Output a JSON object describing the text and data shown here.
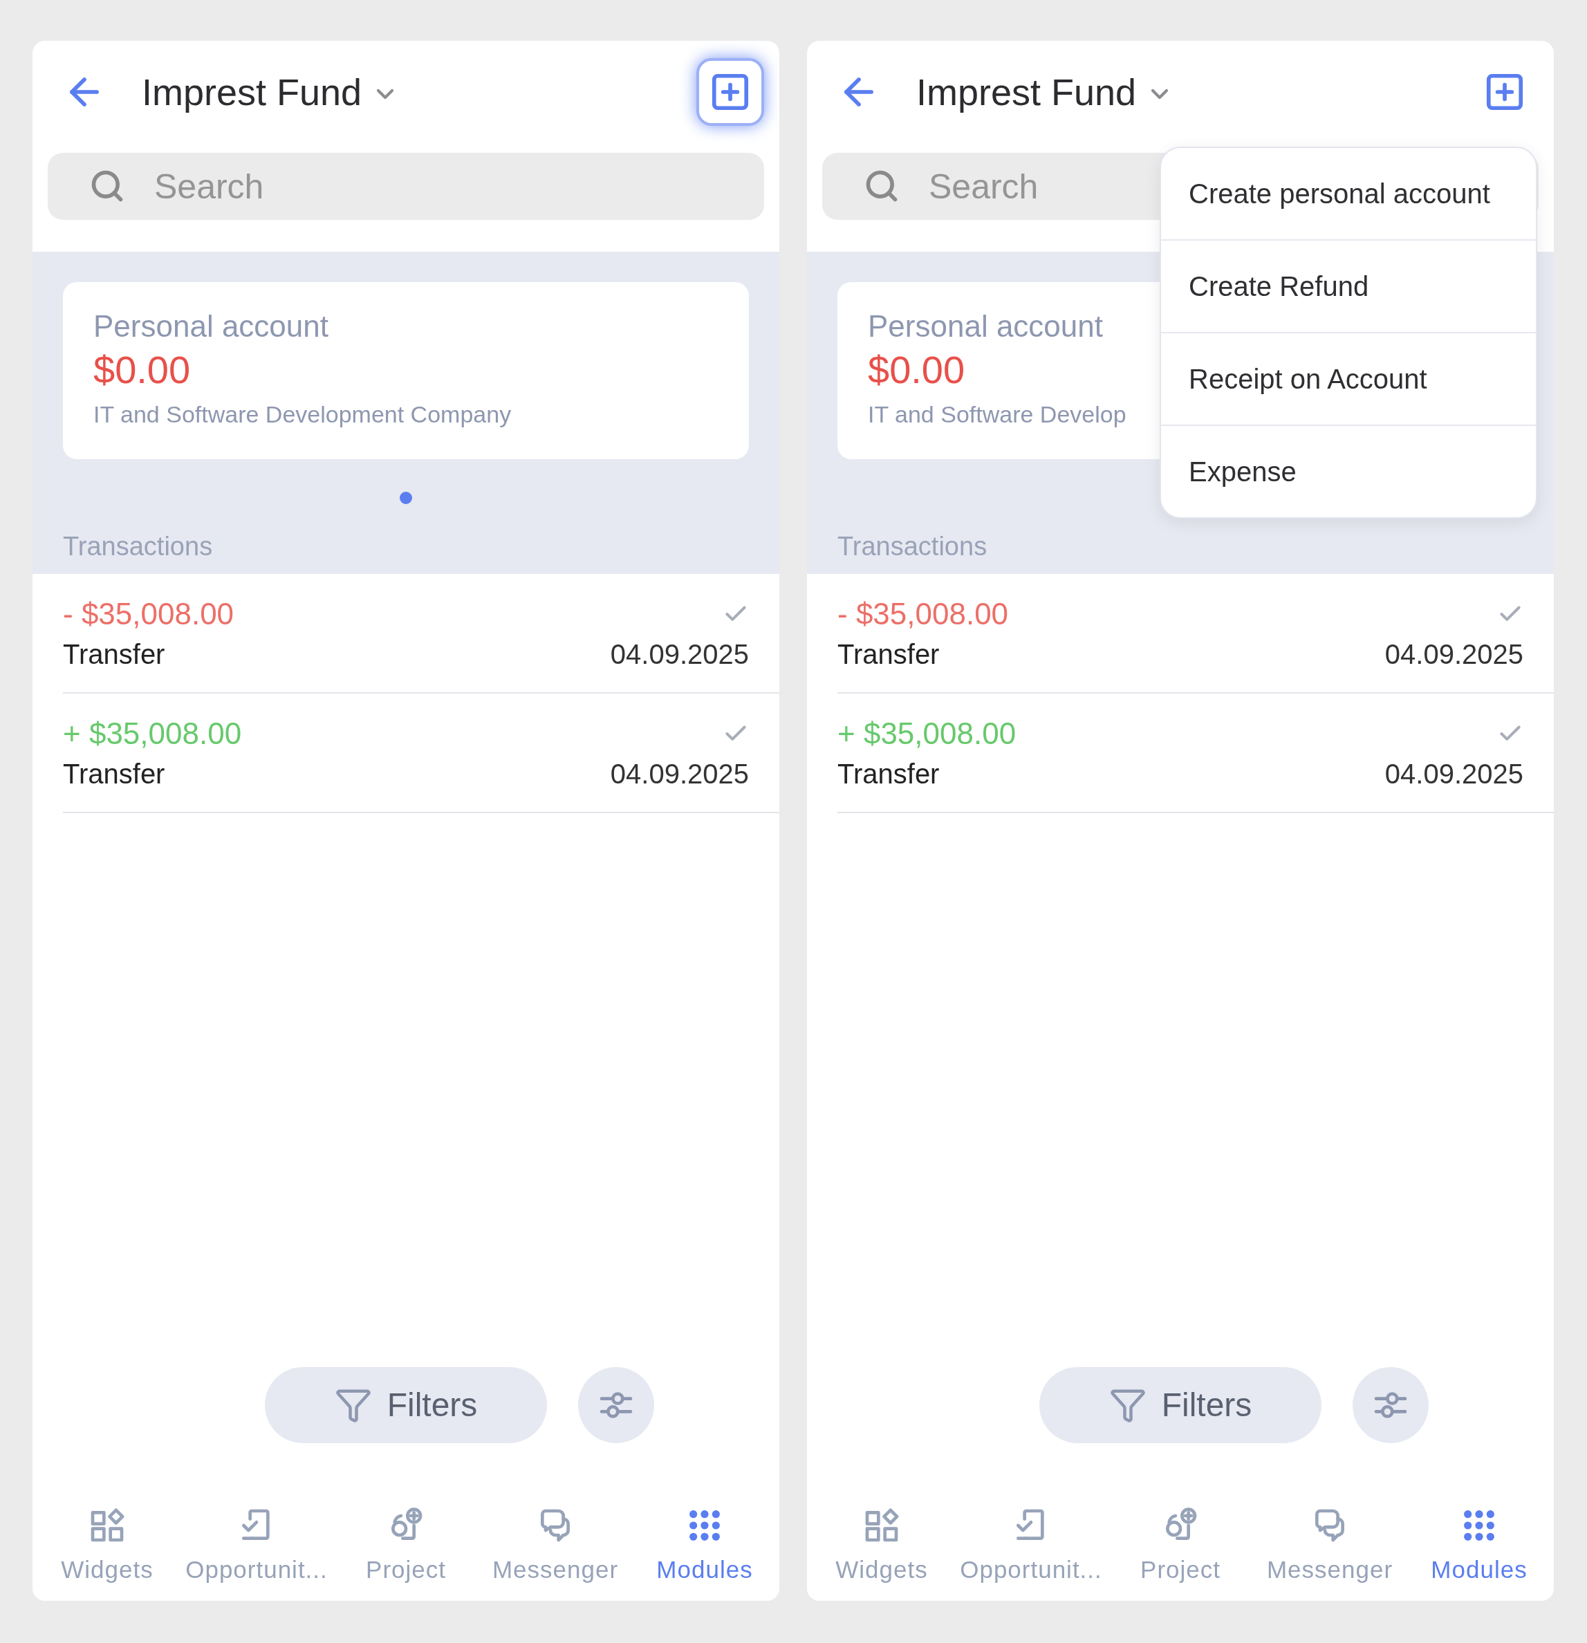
{
  "screens": [
    {
      "title": "Imprest Fund",
      "add_button_focused": true,
      "search": {
        "placeholder": "Search"
      },
      "account_card": {
        "label": "Personal account",
        "balance": "$0.00",
        "company": "IT and Software Development Company"
      },
      "page_dots": [
        {
          "selected": true
        }
      ],
      "section_title": "Transactions",
      "transactions": [
        {
          "kind": "debit",
          "amount": "- $35,008.00",
          "type": "Transfer",
          "date": "04.09.2025",
          "confirmed": true
        },
        {
          "kind": "credit",
          "amount": "+ $35,008.00",
          "type": "Transfer",
          "date": "04.09.2025",
          "confirmed": true
        }
      ],
      "filters_button": "Filters",
      "nav": [
        {
          "kind": "widgets",
          "label": "Widgets",
          "selected": false
        },
        {
          "kind": "opportunities",
          "label": "Opportunit...",
          "selected": false
        },
        {
          "kind": "project",
          "label": "Project",
          "selected": false
        },
        {
          "kind": "messenger",
          "label": "Messenger",
          "selected": false
        },
        {
          "kind": "modules",
          "label": "Modules",
          "selected": true
        }
      ]
    },
    {
      "title": "Imprest Fund",
      "add_button_focused": false,
      "search": {
        "placeholder": "Search"
      },
      "account_card": {
        "label": "Personal account",
        "balance": "$0.00",
        "company": "IT and Software Develop"
      },
      "section_title": "Transactions",
      "transactions": [
        {
          "kind": "debit",
          "amount": "- $35,008.00",
          "type": "Transfer",
          "date": "04.09.2025",
          "confirmed": true
        },
        {
          "kind": "credit",
          "amount": "+ $35,008.00",
          "type": "Transfer",
          "date": "04.09.2025",
          "confirmed": true
        }
      ],
      "filters_button": "Filters",
      "nav": [
        {
          "kind": "widgets",
          "label": "Widgets",
          "selected": false
        },
        {
          "kind": "opportunities",
          "label": "Opportunit...",
          "selected": false
        },
        {
          "kind": "project",
          "label": "Project",
          "selected": false
        },
        {
          "kind": "messenger",
          "label": "Messenger",
          "selected": false
        },
        {
          "kind": "modules",
          "label": "Modules",
          "selected": true
        }
      ],
      "menu": [
        "Create personal account",
        "Create Refund",
        "Receipt on Account",
        "Expense"
      ]
    }
  ]
}
